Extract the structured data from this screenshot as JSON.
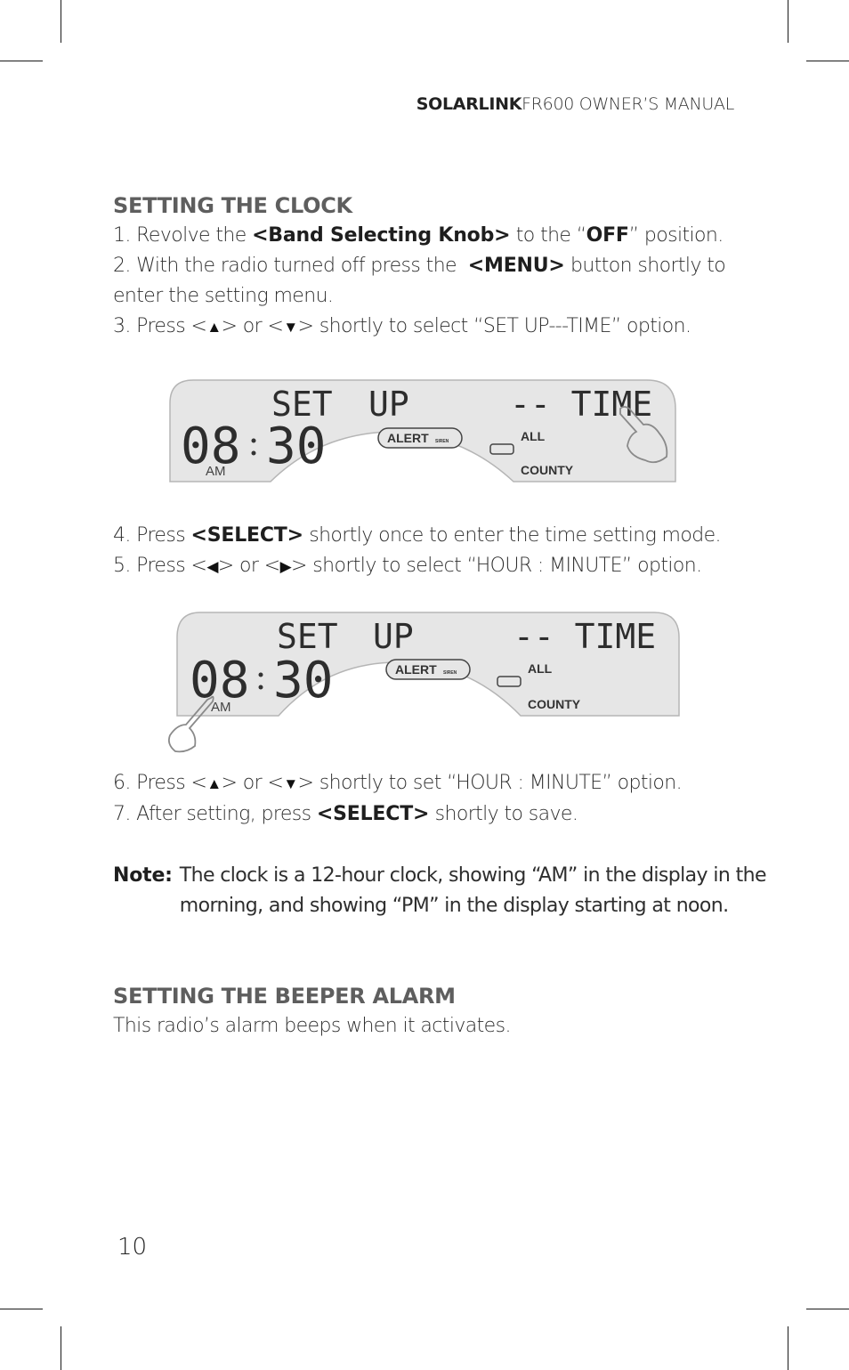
{
  "header": {
    "brand": "SOLARLINK",
    "title": "FR600 OWNER’S MANUAL"
  },
  "section1": {
    "heading": "SETTING THE CLOCK",
    "step1": {
      "pre": "1. Revolve the ",
      "bold": "<Band Selecting Knob>",
      "mid": " to the “",
      "bold2": "OFF",
      "post": "” position."
    },
    "step2": {
      "pre": "2. With the radio turned off press the  ",
      "bold": "<MENU>",
      "post": " button shortly to enter the setting menu."
    },
    "step3": {
      "pre": "3. Press <",
      "icon1": "▲",
      "mid1": "> or <",
      "icon2": "▼",
      "post": "> shortly to select “SET UP---TIME” option."
    },
    "display1": {
      "top_left": "SET",
      "top_mid": "UP",
      "top_right": "-- TIME",
      "clock": "08:30",
      "hour": "08",
      "minute": "30",
      "ampm": "AM",
      "alert_label": "ALERT",
      "alert_sub": "SIREN",
      "all_label": "ALL",
      "county_label": "COUNTY",
      "pointer": "hand-pointer-icon"
    },
    "step4": {
      "pre": "4. Press ",
      "bold": "<SELECT>",
      "post": " shortly once to enter the time setting mode."
    },
    "step5": {
      "pre": "5. Press <",
      "icon1": "◀",
      "mid1": "> or <",
      "icon2": "▶",
      "post": "> shortly to select “HOUR : MINUTE” option."
    },
    "display2": {
      "top_left": "SET",
      "top_mid": "UP",
      "top_right": "-- TIME",
      "hour": "08",
      "minute": "30",
      "ampm": "AM",
      "alert_label": "ALERT",
      "alert_sub": "SIREN",
      "all_label": "ALL",
      "county_label": "COUNTY",
      "pointer": "hand-pointer-icon"
    },
    "step6": {
      "pre": "6. Press <",
      "icon1": "▲",
      "mid1": "> or <",
      "icon2": "▼",
      "post": "> shortly to set “HOUR : MINUTE” option."
    },
    "step7": {
      "pre": "7. After setting, press ",
      "bold": "<SELECT>",
      "post": " shortly to save."
    },
    "note": {
      "label": "Note:",
      "line1": "The clock is a 12-hour clock, showing “AM” in the display in the",
      "line2": "morning, and showing “PM” in the display starting at noon."
    }
  },
  "section2": {
    "heading": "SETTING THE BEEPER ALARM",
    "text": "This radio’s alarm beeps when it activates."
  },
  "footer": {
    "page_number": "10"
  }
}
